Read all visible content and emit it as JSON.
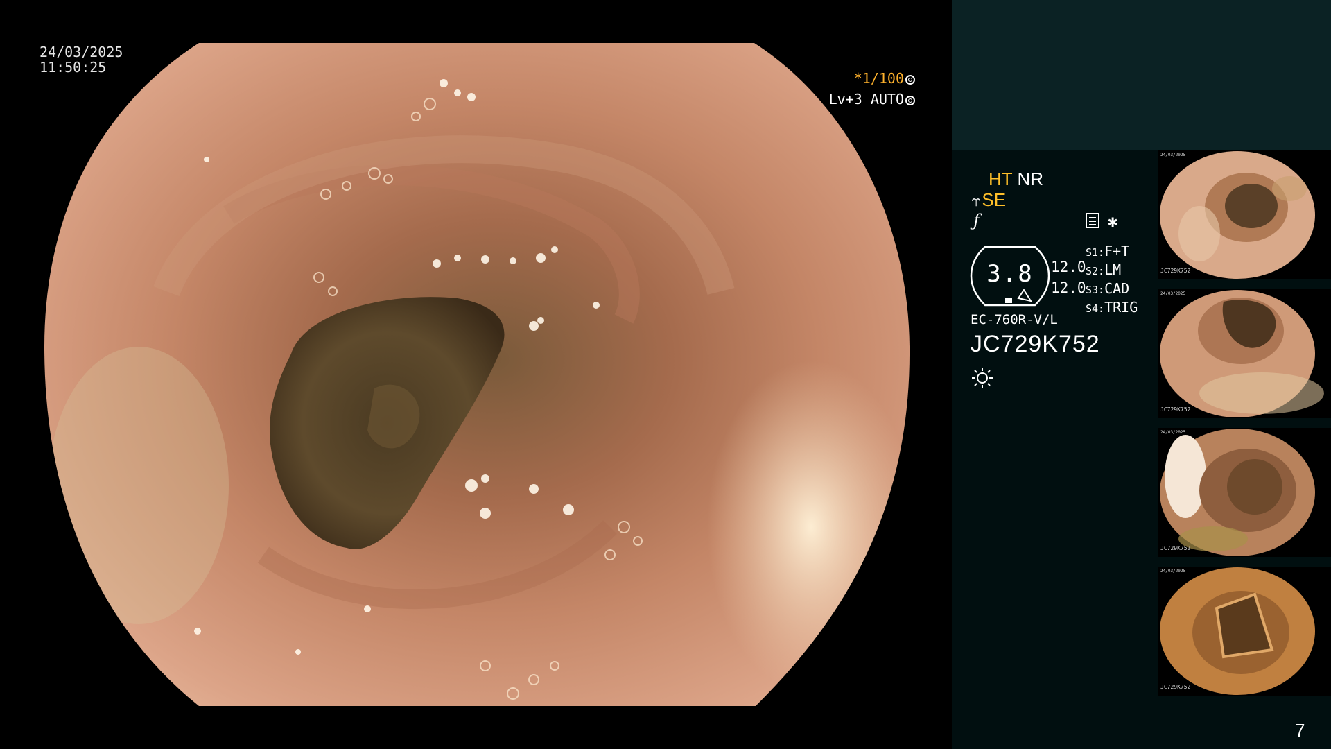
{
  "overlay": {
    "date": "24/03/2025",
    "time": "11:50:25",
    "shutter_prefix": "*1/100",
    "shutter_icon": "aperture-icon",
    "level_text": "Lv+3 AUTO",
    "level_icon": "ring-icon"
  },
  "panel": {
    "ht_label": "HT",
    "nr_label": "NR",
    "se_label": "SE",
    "zoom_value": "3.8",
    "values": [
      "12.0",
      "12.0"
    ],
    "switches": [
      {
        "key": "S1:",
        "value": "F+T"
      },
      {
        "key": "S2:",
        "value": "LM"
      },
      {
        "key": "S3:",
        "value": "CAD"
      },
      {
        "key": "S4:",
        "value": "TRIG"
      }
    ],
    "scope_model": "EC-760R-V/L",
    "serial": "JC729K752",
    "page_number": "7"
  },
  "thumbnails": [
    {
      "label": "JC729K752",
      "date": "24/03/2025"
    },
    {
      "label": "JC729K752",
      "date": "24/03/2025"
    },
    {
      "label": "JC729K752",
      "date": "24/03/2025"
    },
    {
      "label": "JC729K752",
      "date": "24/03/2025"
    }
  ],
  "colors": {
    "accent_yellow": "#ffc02a",
    "panel_top": "#0b2224",
    "panel_bottom": "#010f10",
    "mucosa": "#c98a66"
  }
}
